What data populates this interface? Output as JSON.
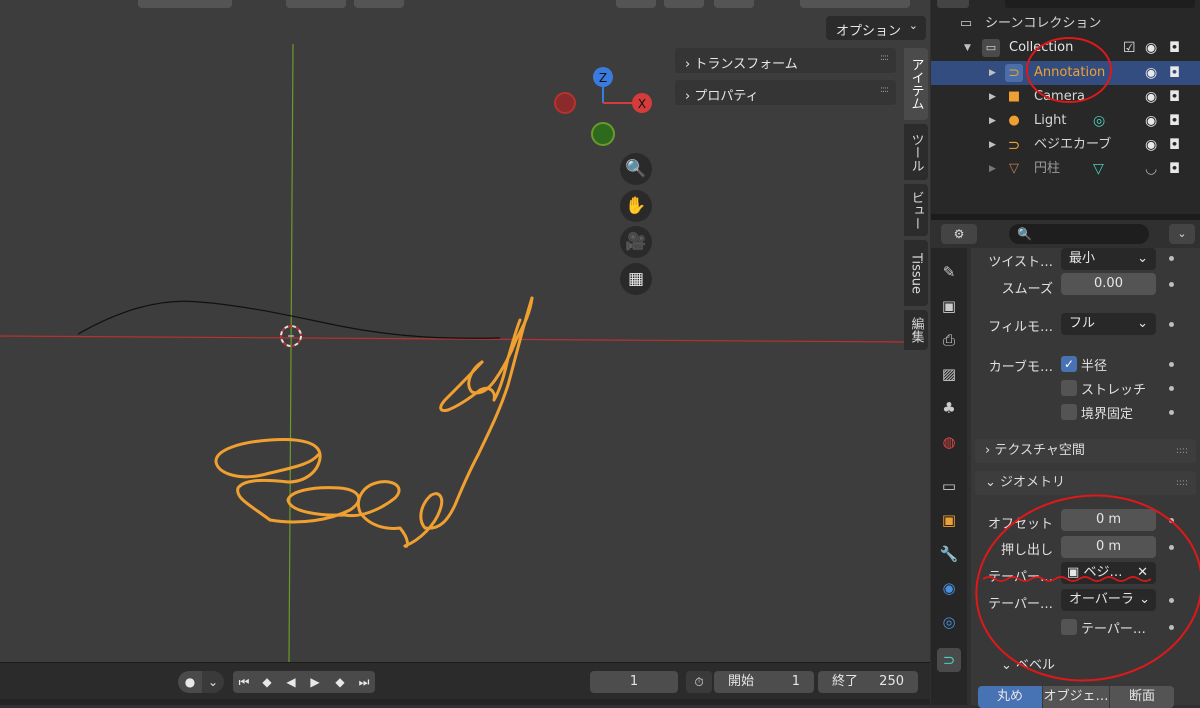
{
  "viewport": {
    "options_label": "オプション",
    "options_chevron": "⌄",
    "npanel": {
      "transform": "トランスフォーム",
      "properties": "プロパティ"
    },
    "side_tabs": [
      "アイテム",
      "ツール",
      "ビュー",
      "Tissue",
      "編集"
    ],
    "gizmo": {
      "z": "Z",
      "x": "X"
    },
    "nav_icons": [
      "zoom-icon",
      "hand-pan-icon",
      "camera-icon",
      "grid-view-icon"
    ],
    "colors": {
      "axis_x": "#b7322e",
      "axis_y": "#6a9a2b",
      "annotation": "#f0a030",
      "background": "#3d3d3d"
    }
  },
  "timeline": {
    "current_frame": "1",
    "start_label": "開始",
    "start_value": "1",
    "end_label": "終了",
    "end_value": "250"
  },
  "outliner": {
    "root": "シーンコレクション",
    "collection": "Collection",
    "items": [
      {
        "name": "Annotation",
        "icon": "annotation-icon",
        "color": "#f0a030",
        "selected": true
      },
      {
        "name": "Camera",
        "icon": "camera-object-icon",
        "color": "#d6d6d6",
        "selected": false
      },
      {
        "name": "Light",
        "icon": "light-icon",
        "color": "#d6d6d6",
        "selected": false
      },
      {
        "name": "ベジエカーブ",
        "icon": "curve-icon",
        "color": "#d6d6d6",
        "selected": false
      },
      {
        "name": "円柱",
        "icon": "cylinder-icon",
        "color": "#a0a0a0",
        "selected": false
      }
    ]
  },
  "properties": {
    "twist_label": "ツイスト…",
    "twist_value": "最小",
    "smooth_label": "スムーズ",
    "smooth_value": "0.00",
    "fill_label": "フィルモ…",
    "fill_value": "フル",
    "curve_label": "カーブモ…",
    "radius_label": "半径",
    "stretch_label": "ストレッチ",
    "bounds_label": "境界固定",
    "texture_space": "テクスチャ空間",
    "geometry": "ジオメトリ",
    "offset_label": "オフセット",
    "offset_value": "0 m",
    "extrude_label": "押し出し",
    "extrude_value": "0 m",
    "taper_label": "テーパー…",
    "taper_value": "ベジ…",
    "taper_mode_label": "テーパー…",
    "taper_mode_value": "オーバーラ",
    "taper_check_label": "テーパー…",
    "bevel": "ベベル",
    "bevel_modes": [
      "丸め",
      "オブジェ…",
      "断面"
    ]
  }
}
